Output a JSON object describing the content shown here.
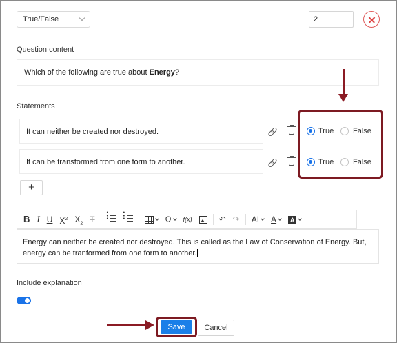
{
  "header": {
    "question_type": "True/False",
    "points_value": "2"
  },
  "question": {
    "section_label": "Question content",
    "text_before": "Which of the following are true about ",
    "text_bold": "Energy",
    "text_after": "?"
  },
  "statements": {
    "section_label": "Statements",
    "items": [
      {
        "text": "It can neither be created nor destroyed.",
        "answer": "True"
      },
      {
        "text": "It can be transformed from one form to another.",
        "answer": "True"
      }
    ],
    "true_label": "True",
    "false_label": "False",
    "add_label": "+"
  },
  "toolbar": {
    "bold": "B",
    "italic": "I",
    "underline": "U",
    "superscript_base": "X",
    "superscript_exp": "2",
    "subscript_base": "X",
    "subscript_exp": "2",
    "clear_format": "T",
    "omega": "Ω",
    "formula": "f(x)",
    "undo": "↶",
    "redo": "↷",
    "font_size": "AI",
    "text_color": "A",
    "bg_color": "A"
  },
  "explanation": {
    "text": "Energy can neither be created nor destroyed. This is called as the Law of Conservation of Energy. But, energy can be tranformed from one form to another.",
    "include_label": "Include explanation",
    "include_enabled": true
  },
  "footer": {
    "save_label": "Save",
    "cancel_label": "Cancel"
  },
  "colors": {
    "accent": "#1a73e8",
    "annotation": "#7d1a22",
    "close": "#e05a5a"
  }
}
